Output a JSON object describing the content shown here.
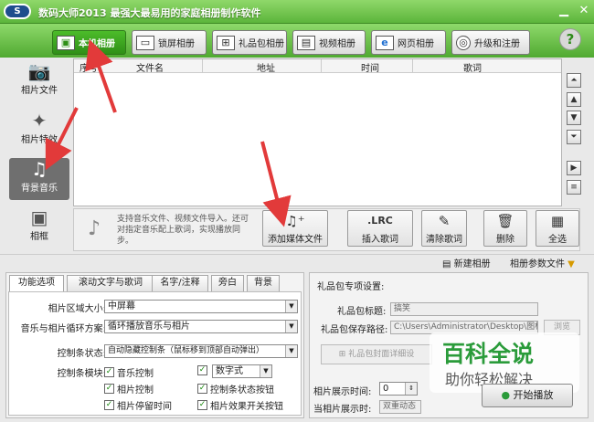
{
  "app": {
    "logo_text": "S",
    "title": "数码大师2013   最强大最易用的家庭相册制作软件"
  },
  "window_controls": {
    "minimize": "▁",
    "close": "✕"
  },
  "tabs": [
    {
      "label": "本机相册",
      "icon": "photo-icon",
      "active": true
    },
    {
      "label": "锁屏相册",
      "icon": "monitor-icon",
      "active": false
    },
    {
      "label": "礼品包相册",
      "icon": "gift-icon",
      "active": false
    },
    {
      "label": "视频相册",
      "icon": "film-icon",
      "active": false
    },
    {
      "label": "网页相册",
      "icon": "ie-icon",
      "active": false
    },
    {
      "label": "升级和注册",
      "icon": "globe-icon",
      "active": false
    }
  ],
  "help": "?",
  "left_nav": [
    {
      "label": "相片文件",
      "icon": "camera-icon",
      "glyph": "📷",
      "active": false
    },
    {
      "label": "相片特效",
      "icon": "effects-icon",
      "glyph": "✦",
      "active": false
    },
    {
      "label": "背景音乐",
      "icon": "music-icon",
      "glyph": "♫",
      "active": true
    },
    {
      "label": "相框",
      "icon": "frame-icon",
      "glyph": "▣",
      "active": false
    }
  ],
  "table": {
    "columns": [
      "序号",
      "文件名",
      "地址",
      "时间",
      "歌词"
    ]
  },
  "media": {
    "note": "支持音乐文件、视频文件导入。还可对指定音乐配上歌词，实现播放同步。",
    "buttons": [
      {
        "label": "添加媒体文件",
        "glyph": "♫⁺"
      },
      {
        "label": "插入歌词",
        "glyph": ".LRC"
      },
      {
        "label": "清除歌词",
        "glyph": "✎"
      },
      {
        "label": "删除",
        "glyph": "🗑"
      },
      {
        "label": "全选",
        "glyph": "▦"
      }
    ]
  },
  "strip": {
    "new_album": "新建相册",
    "album_params": "相册参数文件"
  },
  "bottom_tabs": [
    "功能选项",
    "滚动文字与歌词",
    "名字/注释",
    "旁白",
    "背景"
  ],
  "options": {
    "area_size_label": "相片区域大小:",
    "area_size_value": "中屏幕",
    "loop_label": "音乐与相片循环方案:",
    "loop_value": "循环播放音乐与相片",
    "ctrl_state_label": "控制条状态:",
    "ctrl_state_value": "自动隐藏控制条（鼠标移到顶部自动弹出）",
    "ctrl_module_label": "控制条模块:",
    "checks": [
      "音乐控制",
      "相片控制",
      "相片停留时间",
      "控制条状态按钮",
      "相片效果开关按钮"
    ],
    "digit_value": "数字式"
  },
  "gift": {
    "section_title": "礼品包专项设置:",
    "title_label": "礼品包标题:",
    "title_value": "搞笑",
    "path_label": "礼品包保存路径:",
    "path_value": "C:\\Users\\Administrator\\Desktop\\图标图",
    "browse": "浏览",
    "cover_btn": "礼品包封面详细设",
    "time_label": "相片展示时间:",
    "time_value": "0",
    "current_label": "当相片展示时:",
    "current_value": "双重动态"
  },
  "start_btn": "开始播放",
  "watermark": {
    "title": "百科全说",
    "subtitle": "助你轻松解决"
  }
}
